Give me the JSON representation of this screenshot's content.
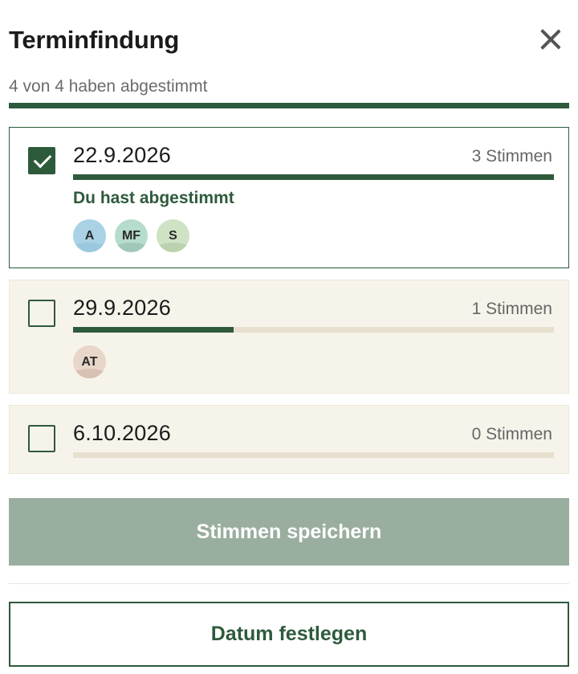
{
  "header": {
    "title": "Terminfindung",
    "close_icon": "close-icon"
  },
  "summary": {
    "text": "4 von 4 haben abgestimmt",
    "voted": 4,
    "total": 4
  },
  "options": [
    {
      "date": "22.9.2026",
      "votes_label": "3 Stimmen",
      "votes": 3,
      "checked": true,
      "you_voted": "Du hast abgestimmt",
      "avatars": [
        "A",
        "MF",
        "S"
      ]
    },
    {
      "date": "29.9.2026",
      "votes_label": "1 Stimmen",
      "votes": 1,
      "checked": false,
      "avatars": [
        "AT"
      ]
    },
    {
      "date": "6.10.2026",
      "votes_label": "0 Stimmen",
      "votes": 0,
      "checked": false,
      "avatars": []
    }
  ],
  "actions": {
    "save_label": "Stimmen speichern",
    "fix_label": "Datum festlegen"
  },
  "colors": {
    "accent": "#2e5a3c",
    "muted_button": "#9aae9f",
    "option_bg": "#f6f3ea",
    "track": "#e8e0cf"
  }
}
